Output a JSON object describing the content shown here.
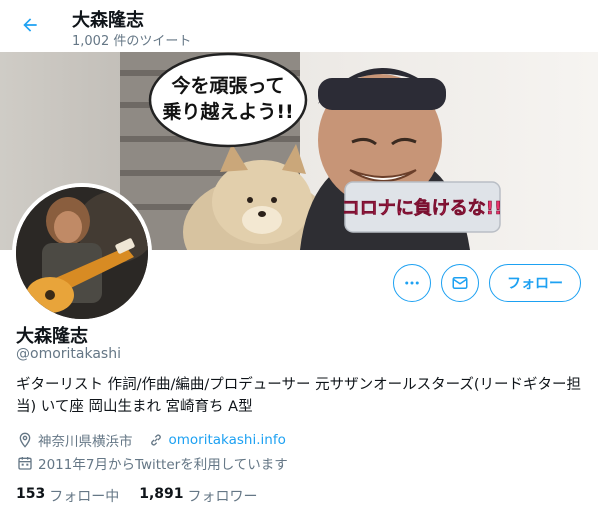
{
  "header": {
    "title": "大森隆志",
    "tweet_count": "1,002 件のツイート"
  },
  "banner": {
    "speech_bubble_line1": "今を頑張って",
    "speech_bubble_line2": "乗り越えよう!!",
    "sticker_text": "コロナに負けるな!!"
  },
  "actions": {
    "more_icon": "more-icon",
    "message_icon": "envelope-icon",
    "follow_label": "フォロー"
  },
  "profile": {
    "name": "大森隆志",
    "handle": "@omoritakashi",
    "bio": "ギターリスト 作詞/作曲/編曲/プロデューサー 元サザンオールスターズ(リードギター担当) いて座 岡山生まれ 宮崎育ち A型",
    "location": "神奈川県横浜市",
    "website": "omoritakashi.info",
    "joined": "2011年7月からTwitterを利用しています"
  },
  "stats": {
    "following_count": "153",
    "following_label": "フォロー中",
    "followers_count": "1,891",
    "followers_label": "フォロワー"
  },
  "colors": {
    "accent": "#1da1f2",
    "text": "#0f1419",
    "muted": "#657786"
  }
}
